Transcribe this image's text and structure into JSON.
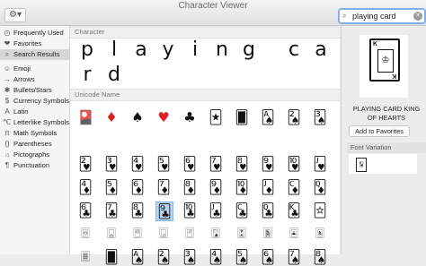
{
  "window": {
    "title": "Character Viewer",
    "gear_label": "⚙▾",
    "search_value": "playing card"
  },
  "sidebar": {
    "items": [
      {
        "icon": "clock-icon",
        "glyph": "◷",
        "label": "Frequently Used",
        "selected": false
      },
      {
        "icon": "heart-icon",
        "glyph": "❤",
        "label": "Favorites",
        "selected": false
      },
      {
        "icon": "search-icon",
        "glyph": "⌕",
        "label": "Search Results",
        "selected": true
      },
      {
        "icon": "emoji-icon",
        "glyph": "☺",
        "label": "Emoji",
        "selected": false
      },
      {
        "icon": "arrow-icon",
        "glyph": "→",
        "label": "Arrows",
        "selected": false
      },
      {
        "icon": "star-icon",
        "glyph": "✱",
        "label": "Bullets/Stars",
        "selected": false
      },
      {
        "icon": "currency-icon",
        "glyph": "$",
        "label": "Currency Symbols",
        "selected": false
      },
      {
        "icon": "latin-icon",
        "glyph": "A",
        "label": "Latin",
        "selected": false
      },
      {
        "icon": "letterlike-icon",
        "glyph": "℃",
        "label": "Letterlike Symbols",
        "selected": false
      },
      {
        "icon": "math-icon",
        "glyph": "π",
        "label": "Math Symbols",
        "selected": false
      },
      {
        "icon": "paren-icon",
        "glyph": "()",
        "label": "Parentheses",
        "selected": false
      },
      {
        "icon": "pictograph-icon",
        "glyph": "☼",
        "label": "Pictographs",
        "selected": false
      },
      {
        "icon": "punctuation-icon",
        "glyph": "¶",
        "label": "Punctuation",
        "selected": false
      }
    ]
  },
  "main": {
    "character_header": "Character",
    "character_row1": [
      "p",
      "l",
      "a",
      "y",
      "i",
      "n",
      "g",
      "c",
      "a"
    ],
    "character_row2": [
      "r",
      "d"
    ],
    "unicode_header": "Unicode Name",
    "symbols": [
      "🎴",
      "♦",
      "♠",
      "♥",
      "♣",
      "🃏"
    ],
    "card_rows": [
      [
        "🂠",
        "🂡",
        "🂢",
        "🂣",
        "🂤",
        "🂥",
        "🂦",
        "🂧",
        "🂨",
        "🂩",
        "🂪",
        "🂫",
        "🂬",
        "🂭",
        "🂮",
        "🂱"
      ],
      [
        "🂲",
        "🂳",
        "🂴",
        "🂵",
        "🂶",
        "🂷",
        "🂸",
        "🂹",
        "🂺",
        "🂻",
        "🂼",
        "🂽",
        "🂾",
        "🃁",
        "🃂",
        "🃃"
      ],
      [
        "🃄",
        "🃅",
        "🃆",
        "🃇",
        "🃈",
        "🃉",
        "🃊",
        "🃋",
        "🃌",
        "🃍",
        "🃎",
        "🃑",
        "🃒",
        "🃓",
        "🃔",
        "🃕"
      ],
      [
        "🃖",
        "🃗",
        "🃘",
        "🃙",
        "🃚",
        "🃛",
        "🃜",
        "🃝",
        "🃞",
        "🃟",
        "🂿",
        "🃠",
        "🃡",
        "🃢",
        "🃣",
        "🃤"
      ],
      [
        "🃥",
        "🃦",
        "🃧",
        "🃨",
        "🃩",
        "🃪",
        "🃫",
        "🃬",
        "🃭",
        "🃮",
        "🃯",
        "🃰",
        "🃱",
        "🃲",
        "🃳",
        "🃴"
      ],
      [
        "🃵",
        "🂠",
        "🂡",
        "🂢",
        "🂣",
        "🂤",
        "🂥",
        "🂦",
        "🂧",
        "🂨",
        "🂩",
        "🂪",
        "🂫",
        "🂬",
        "🂭",
        "🂮"
      ]
    ],
    "selected_row": 3,
    "selected_col": 3
  },
  "detail": {
    "preview_index": "K",
    "character_name": "PLAYING CARD KING OF HEARTS",
    "favorites_button": "Add to Favorites",
    "font_variation_header": "Font Variation"
  }
}
